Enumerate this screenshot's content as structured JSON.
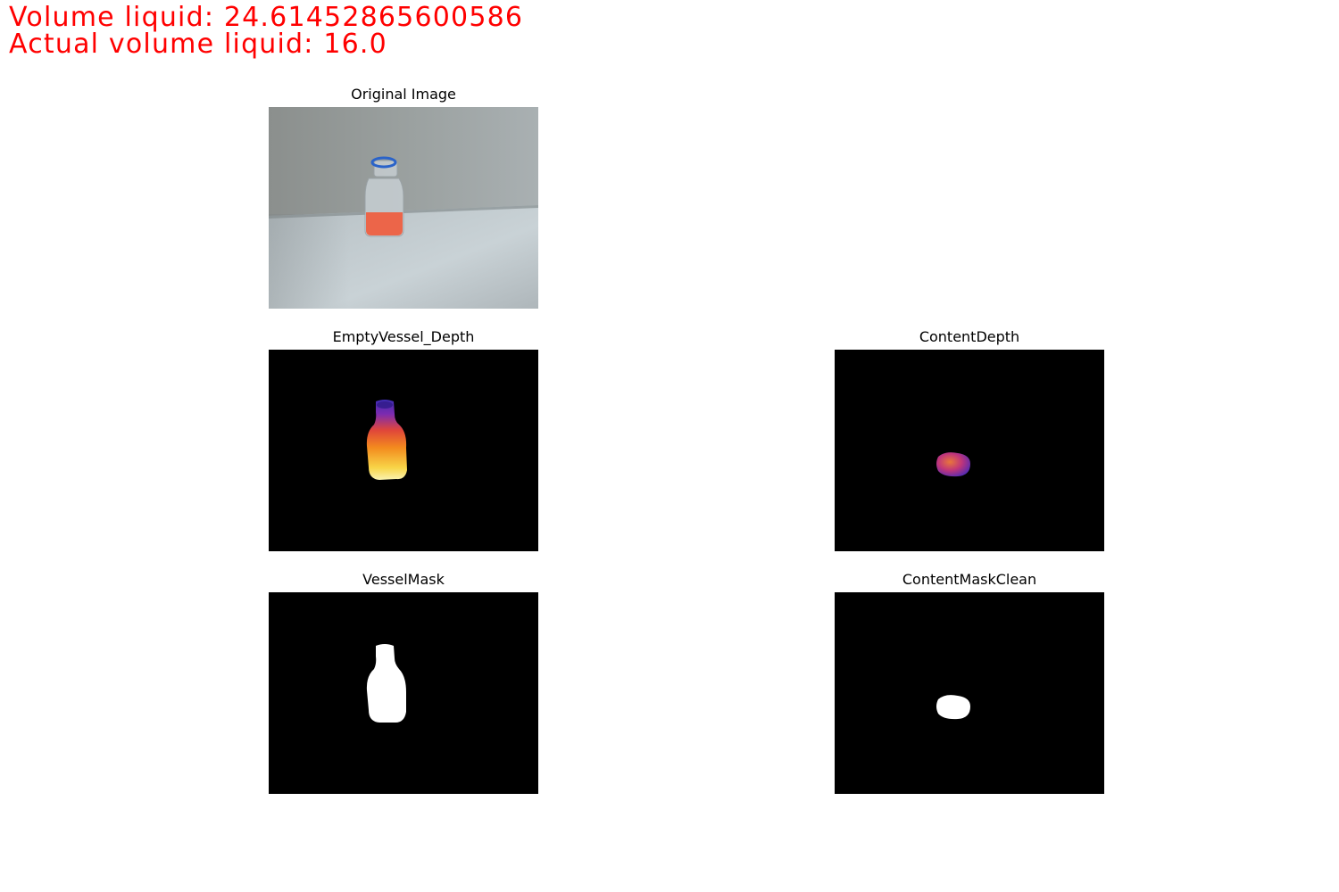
{
  "overlay": {
    "line1": "Volume liquid: 24.614528656005​86",
    "line2": "Actual volume liquid: 16.0",
    "color": "#ff0000"
  },
  "panels": {
    "original": {
      "title": "Original Image"
    },
    "empty_vessel_depth": {
      "title": "EmptyVessel_Depth"
    },
    "content_depth": {
      "title": "ContentDepth"
    },
    "vessel_mask": {
      "title": "VesselMask"
    },
    "content_mask_clean": {
      "title": "ContentMaskClean"
    }
  },
  "colors": {
    "background": "#ffffff",
    "panel_dark": "#000000",
    "mask_fill": "#ffffff",
    "liquid": "#f05a3a",
    "bottle_cap": "#2a63c9"
  }
}
